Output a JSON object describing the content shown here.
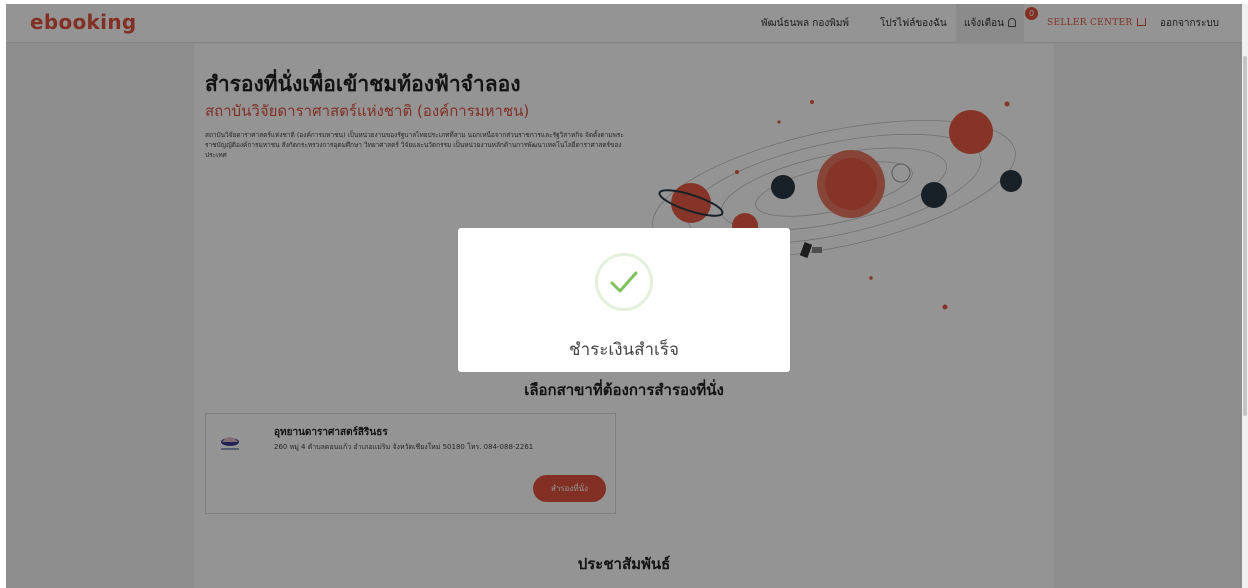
{
  "nav": {
    "logo": "ebooking",
    "user_name": "พัฒน์ธนพล กองพิมพ์",
    "profile": "โปรไฟล์ของฉัน",
    "notifications": "แจ้งเตือน",
    "notification_count": "0",
    "seller_center": "SELLER CENTER",
    "logout": "ออกจากระบบ"
  },
  "page": {
    "title": "สำรองที่นั่งเพื่อเข้าชมท้องฟ้าจำลอง",
    "org_name": "สถาบันวิจัยดาราศาสตร์แห่งชาติ (องค์การมหาชน)",
    "description": "สถาบันวิจัยดาราศาสตร์แห่งชาติ (องค์การมหาชน) เป็นหน่วยงานของรัฐบาลไทยประเภทที่สาม นอกเหนือจากส่วนราชการและรัฐวิสาหกิจ จัดตั้งตามพระราชบัญญัติองค์การมหาชน สังกัดกระทรวงการอุดมศึกษา วิทยาศาสตร์ วิจัยและนวัตกรรม เป็นหน่วยงานหลักด้านการพัฒนาเทคโนโลยีดาราศาสตร์ของประเทศ",
    "branch_section_title": "เลือกสาขาที่ต้องการสำรองที่นั่ง",
    "pr_section_title": "ประชาสัมพันธ์"
  },
  "branch": {
    "name": "อุทยานดาราศาสตร์สิรินธร",
    "address": "260 หมู่ 4 ตำบลดอนแก้ว อำเภอแม่ริม จังหวัดเชียงใหม่ 50180 โทร. 084-088-2261",
    "book_label": "สำรองที่นั่ง"
  },
  "modal": {
    "message": "ชำระเงินสำเร็จ",
    "icon": "check-circle-icon"
  },
  "colors": {
    "accent": "#e0533f",
    "success": "#7cc25d",
    "overlay": "rgba(0,0,0,0.42)"
  }
}
